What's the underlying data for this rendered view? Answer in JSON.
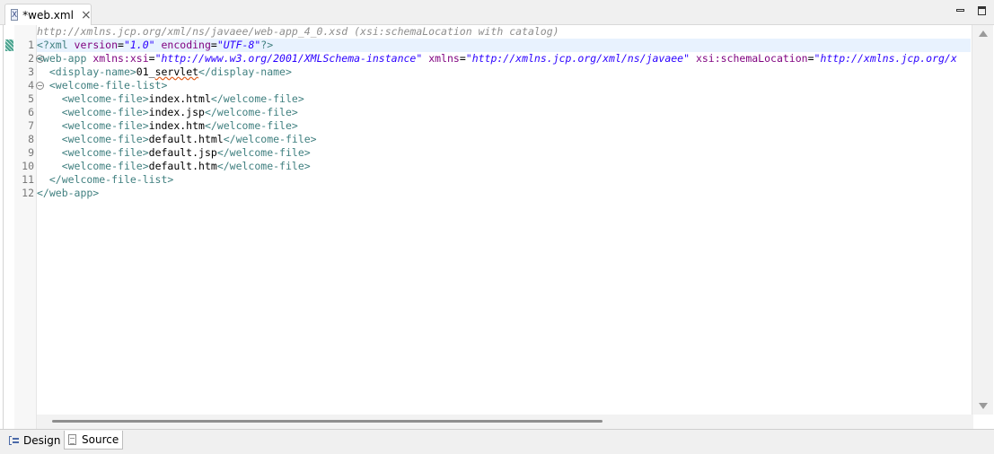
{
  "tab": {
    "title": "*web.xml",
    "file_icon": "xml-file-icon",
    "close": "×"
  },
  "schema_hint": "http://xmlns.jcp.org/xml/ns/javaee/web-app_4_0.xsd (xsi:schemaLocation with catalog)",
  "line_numbers": [
    "1",
    "2",
    "3",
    "4",
    "5",
    "6",
    "7",
    "8",
    "9",
    "10",
    "11",
    "12"
  ],
  "code": {
    "l1": {
      "open": "<?xml ",
      "a1": "version",
      "eq1": "=",
      "v1": "\"1.0\"",
      "a2": " encoding",
      "eq2": "=",
      "v2": "\"UTF-8\"",
      "close": "?>"
    },
    "l2": {
      "open": "<web-app ",
      "a1": "xmlns:xsi",
      "eq1": "=",
      "v1": "\"http://www.w3.org/2001/XMLSchema-instance\"",
      "a2": " xmlns",
      "eq2": "=",
      "v2": "\"http://xmlns.jcp.org/xml/ns/javaee\"",
      "a3": " xsi:schemaLocation",
      "eq3": "=",
      "v3": "\"http://xmlns.jcp.org/x"
    },
    "l3": {
      "indent": "  ",
      "open": "<display-name>",
      "text_a": "01_",
      "text_b": "servlet",
      "close": "</display-name>"
    },
    "l4": {
      "indent": "  ",
      "tag": "<welcome-file-list>"
    },
    "files": [
      {
        "indent": "    ",
        "open": "<welcome-file>",
        "text": "index.html",
        "close": "</welcome-file>"
      },
      {
        "indent": "    ",
        "open": "<welcome-file>",
        "text": "index.jsp",
        "close": "</welcome-file>"
      },
      {
        "indent": "    ",
        "open": "<welcome-file>",
        "text": "index.htm",
        "close": "</welcome-file>"
      },
      {
        "indent": "    ",
        "open": "<welcome-file>",
        "text": "default.html",
        "close": "</welcome-file>"
      },
      {
        "indent": "    ",
        "open": "<welcome-file>",
        "text": "default.jsp",
        "close": "</welcome-file>"
      },
      {
        "indent": "    ",
        "open": "<welcome-file>",
        "text": "default.htm",
        "close": "</welcome-file>"
      }
    ],
    "l11": {
      "indent": "  ",
      "tag": "</welcome-file-list>"
    },
    "l12": {
      "tag": "</web-app>"
    }
  },
  "bottom_tabs": {
    "design": "Design",
    "source": "Source"
  },
  "colors": {
    "tag": "#3f7f7f",
    "attribute": "#7f007f",
    "value": "#2a00ff",
    "current_line": "#e8f2fe"
  }
}
